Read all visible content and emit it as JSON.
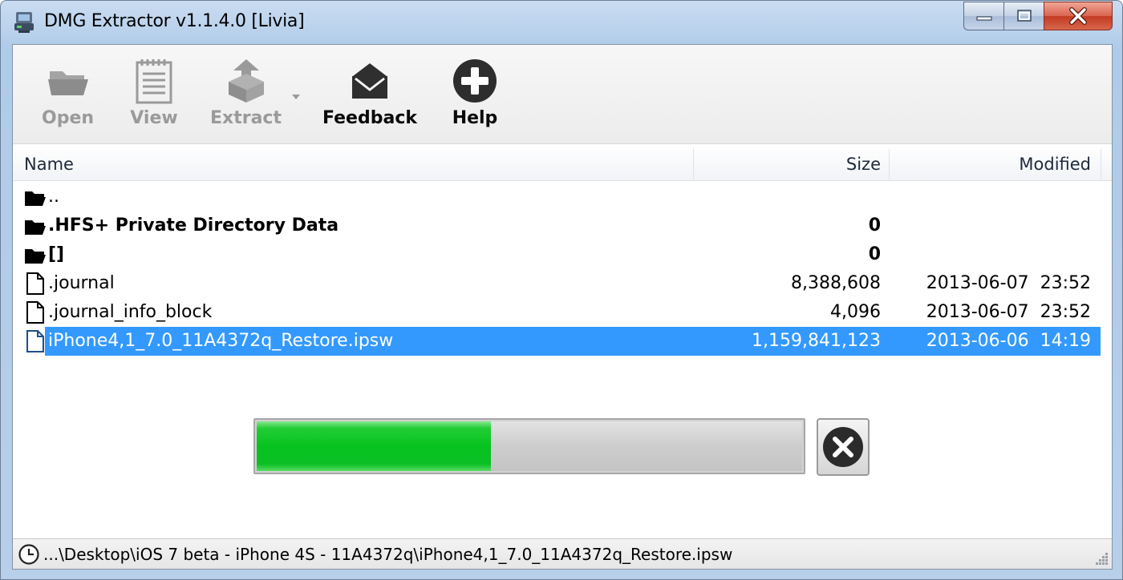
{
  "window": {
    "title": "DMG Extractor v1.1.4.0 [Livia]"
  },
  "toolbar": {
    "open_label": "Open",
    "view_label": "View",
    "extract_label": "Extract",
    "feedback_label": "Feedback",
    "help_label": "Help"
  },
  "columns": {
    "name": "Name",
    "size": "Size",
    "modified": "Modified"
  },
  "files": [
    {
      "icon": "folder-icon",
      "name": "..",
      "size": "",
      "modified": "",
      "bold": false,
      "selected": false
    },
    {
      "icon": "folder-icon",
      "name": ".HFS+ Private Directory Data",
      "size": "0",
      "modified": "",
      "bold": true,
      "selected": false
    },
    {
      "icon": "folder-icon",
      "name": "[]",
      "size": "0",
      "modified": "",
      "bold": true,
      "selected": false
    },
    {
      "icon": "file-icon",
      "name": ".journal",
      "size": "8,388,608",
      "modified": "2013-06-07  23:52",
      "bold": false,
      "selected": false
    },
    {
      "icon": "file-icon",
      "name": ".journal_info_block",
      "size": "4,096",
      "modified": "2013-06-07  23:52",
      "bold": false,
      "selected": false
    },
    {
      "icon": "file-icon",
      "name": "iPhone4,1_7.0_11A4372q_Restore.ipsw",
      "size": "1,159,841,123",
      "modified": "2013-06-06  14:19",
      "bold": false,
      "selected": true
    }
  ],
  "progress": {
    "fraction": 0.43
  },
  "statusbar": {
    "path": "...\\Desktop\\iOS 7 beta - iPhone 4S - 11A4372q\\iPhone4,1_7.0_11A4372q_Restore.ipsw"
  },
  "colors": {
    "selection": "#3399ff",
    "progress_green": "#06c31f",
    "close_red": "#c23b22"
  }
}
